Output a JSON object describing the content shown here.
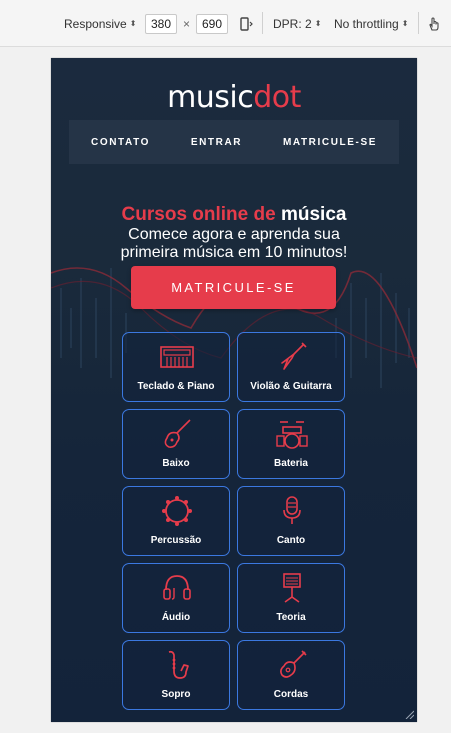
{
  "devtools": {
    "device": "Responsive",
    "width": "380",
    "times": "×",
    "height": "690",
    "dpr": "DPR: 2",
    "throttling": "No throttling"
  },
  "site": {
    "logo_main": "music",
    "logo_accent": "dot",
    "nav": [
      "CONTATO",
      "ENTRAR",
      "MATRICULE-SE"
    ],
    "headline_red": "Cursos online de",
    "headline_white": "música",
    "subtitle_line1": "Comece agora e aprenda sua",
    "subtitle_line2": "primeira música em 10 minutos!",
    "cta": "MATRICULE-SE",
    "courses": [
      {
        "label": "Teclado & Piano",
        "icon": "keyboard-icon"
      },
      {
        "label": "Violão & Guitarra",
        "icon": "guitar-icon"
      },
      {
        "label": "Baixo",
        "icon": "bass-icon"
      },
      {
        "label": "Bateria",
        "icon": "drums-icon"
      },
      {
        "label": "Percussão",
        "icon": "tambourine-icon"
      },
      {
        "label": "Canto",
        "icon": "microphone-icon"
      },
      {
        "label": "Áudio",
        "icon": "headphones-icon"
      },
      {
        "label": "Teoria",
        "icon": "music-stand-icon"
      },
      {
        "label": "Sopro",
        "icon": "saxophone-icon"
      },
      {
        "label": "Cordas",
        "icon": "ukulele-icon"
      }
    ]
  },
  "colors": {
    "accent": "#e63c4b",
    "card_border": "#3b78e0",
    "background": "#1a2a3b"
  }
}
